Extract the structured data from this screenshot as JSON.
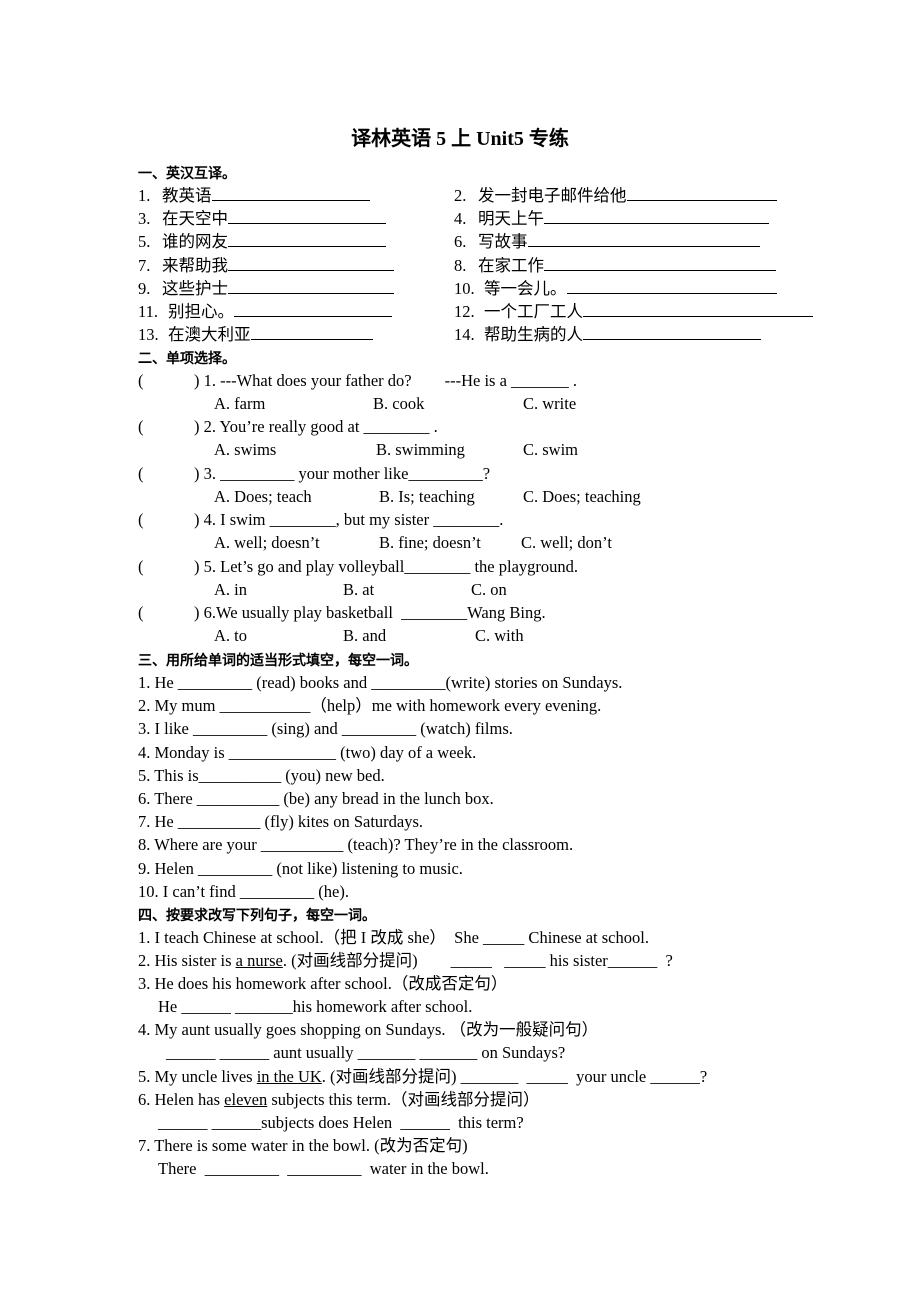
{
  "title": "译林英语 5 上  Unit5 专练",
  "section1": {
    "heading": "一、英汉互译。",
    "items": [
      {
        "num": "1.",
        "text": "教英语"
      },
      {
        "num": "2.",
        "text": "发一封电子邮件给他"
      },
      {
        "num": "3.",
        "text": "在天空中"
      },
      {
        "num": "4.",
        "text": "明天上午"
      },
      {
        "num": "5.",
        "text": "谁的网友"
      },
      {
        "num": "6.",
        "text": "写故事"
      },
      {
        "num": "7.",
        "text": "来帮助我"
      },
      {
        "num": "8.",
        "text": "在家工作"
      },
      {
        "num": "9.",
        "text": "这些护士"
      },
      {
        "num": "10.",
        "text": "等一会儿。"
      },
      {
        "num": "11.",
        "text": "别担心。"
      },
      {
        "num": "12.",
        "text": "一个工厂工人"
      },
      {
        "num": "13.",
        "text": "在澳大利亚"
      },
      {
        "num": "14.",
        "text": "帮助生病的人"
      }
    ]
  },
  "section2": {
    "heading": "二、单项选择。",
    "questions": [
      {
        "stem": ") 1. ---What does your father do?        ---He is a _______ .",
        "options": [
          "A. farm",
          "B. cook",
          "C. write"
        ]
      },
      {
        "stem": ") 2. You’re really good at ________ .",
        "options": [
          "A. swims",
          "B. swimming",
          "C. swim"
        ]
      },
      {
        "stem": ") 3. _________ your mother like_________?",
        "options": [
          "A. Does; teach",
          "B. Is; teaching",
          "C. Does; teaching"
        ]
      },
      {
        "stem": ") 4. I swim ________, but my sister ________.",
        "options": [
          "A. well; doesn’t",
          "B. fine; doesn’t",
          "C. well; don’t"
        ]
      },
      {
        "stem": ") 5. Let’s go and play volleyball________ the playground.",
        "options": [
          "A. in",
          "B. at",
          "C. on"
        ]
      },
      {
        "stem": ") 6.We usually play basketball  ________Wang Bing.",
        "options": [
          "A. to",
          "B. and",
          "C. with"
        ]
      }
    ]
  },
  "section3": {
    "heading": "三、用所给单词的适当形式填空，每空一词。",
    "items": [
      "1. He _________ (read) books and _________(write) stories on Sundays.",
      "2. My mum ___________（help）me with homework every evening.",
      "3. I like _________ (sing) and _________ (watch) films.",
      "4. Monday is _____________ (two) day of a week.",
      "5. This is__________ (you) new bed.",
      "6. There __________ (be) any bread in the lunch box.",
      "7. He __________ (fly) kites on Saturdays.",
      "8. Where are your __________ (teach)? They’re in the classroom.",
      "9. Helen _________ (not like) listening to music.",
      "10. I can’t find _________ (he)."
    ]
  },
  "section4": {
    "heading": "四、按要求改写下列句子，每空一词。",
    "q1": {
      "a": "1. I teach Chinese at school.（把 I 改成 she）  She _____ Chinese at school."
    },
    "q2": {
      "pre": "2. His sister is ",
      "u": "a nurse",
      "post": ". (对画线部分提问)        _____   _____ his sister______  ?"
    },
    "q3": {
      "a": "3. He does his homework after school.（改成否定句）",
      "b": "He ______ _______his homework after school."
    },
    "q4": {
      "a": "4. My aunt usually goes shopping on Sundays. （改为一般疑问句）",
      "b": "______ ______ aunt usually _______ _______ on Sundays?"
    },
    "q5": {
      "pre": "5. My uncle lives ",
      "u": "in the UK",
      "post": ". (对画线部分提问) _______  _____  your uncle ______?"
    },
    "q6": {
      "pre": "6. Helen has ",
      "u": "eleven",
      "post": " subjects this term.（对画线部分提问）",
      "b": "______ ______subjects does Helen  ______  this term?"
    },
    "q7": {
      "a": "7. There is some water in the bowl. (改为否定句)",
      "b": "There  _________  _________  water in the bowl."
    }
  }
}
